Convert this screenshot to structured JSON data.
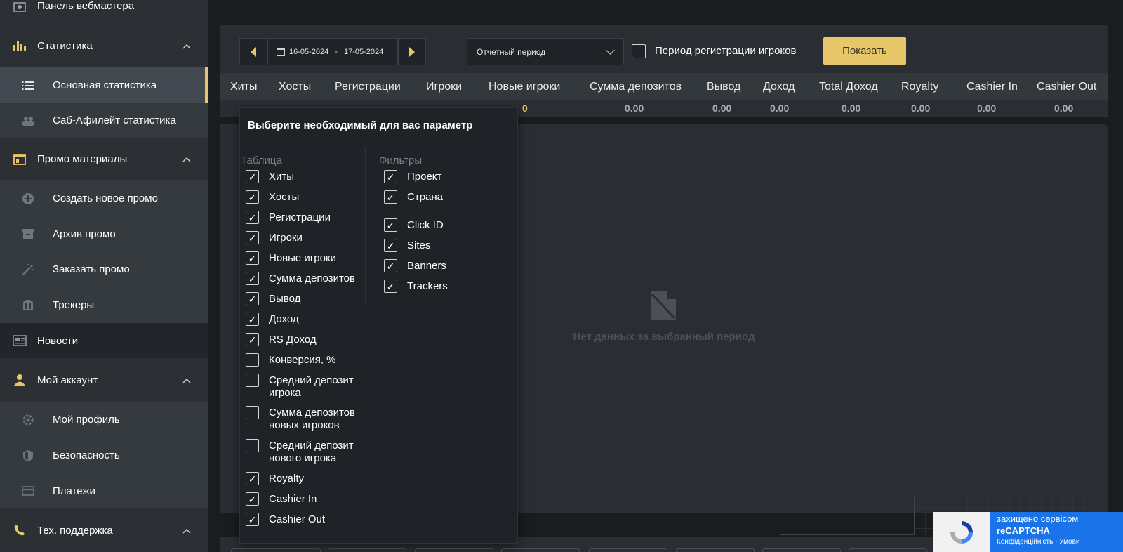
{
  "sidebar": {
    "items": [
      {
        "label": "Панель вебмастера",
        "icon": "dashboard-icon"
      },
      {
        "label": "Статистика",
        "icon": "bar-chart-icon"
      },
      {
        "label": "Основная статистика",
        "icon": "list-icon"
      },
      {
        "label": "Саб-Афилейт статистика",
        "icon": "sub-affiliate-icon"
      },
      {
        "label": "Промо материалы",
        "icon": "promo-icon"
      },
      {
        "label": "Создать новое промо",
        "icon": "plus-circle-icon"
      },
      {
        "label": "Архив промо",
        "icon": "archive-icon"
      },
      {
        "label": "Заказать промо",
        "icon": "magic-wand-icon"
      },
      {
        "label": "Трекеры",
        "icon": "tracker-icon"
      },
      {
        "label": "Новости",
        "icon": "news-icon"
      },
      {
        "label": "Мой аккаунт",
        "icon": "user-icon"
      },
      {
        "label": "Мой профиль",
        "icon": "gear-icon"
      },
      {
        "label": "Безопасность",
        "icon": "shield-icon"
      },
      {
        "label": "Платежи",
        "icon": "card-icon"
      },
      {
        "label": "Тех. поддержка",
        "icon": "phone-icon"
      }
    ]
  },
  "filters": {
    "date_from": "16-05-2024",
    "date_sep": "-",
    "date_to": "17-05-2024",
    "period_select": "Отчетный период",
    "reg_period_label": "Период регистрации игроков",
    "show_button": "Показать"
  },
  "table": {
    "headers": [
      "Хиты",
      "Хосты",
      "Регистрации",
      "Игроки",
      "Новые игроки",
      "Сумма депозитов",
      "Вывод",
      "Доход",
      "Total Доход",
      "Royalty",
      "Cashier In",
      "Cashier Out"
    ],
    "values": [
      "0",
      "0.00",
      "0.00",
      "0.00",
      "0.00",
      "0.00",
      "0.00",
      "0.00"
    ]
  },
  "empty": {
    "message": "Нет данных за выбранный период"
  },
  "popover": {
    "title": "Выберите необходимый для вас параметр",
    "table_group": "Таблица",
    "filters_group": "Фильтры",
    "table_options": [
      {
        "label": "Хиты",
        "checked": true
      },
      {
        "label": "Хосты",
        "checked": true
      },
      {
        "label": "Регистрации",
        "checked": true
      },
      {
        "label": "Игроки",
        "checked": true
      },
      {
        "label": "Новые игроки",
        "checked": true
      },
      {
        "label": "Сумма депозитов",
        "checked": true
      },
      {
        "label": "Вывод",
        "checked": true
      },
      {
        "label": "Доход",
        "checked": true
      },
      {
        "label": "RS Доход",
        "checked": true
      },
      {
        "label": "Конверсия, %",
        "checked": false
      },
      {
        "label": "Средний депозит игрока",
        "checked": false
      },
      {
        "label": "Сумма депозитов новых игроков",
        "checked": false
      },
      {
        "label": "Средний депозит нового игрока",
        "checked": false
      },
      {
        "label": "Royalty",
        "checked": true
      },
      {
        "label": "Cashier In",
        "checked": true
      },
      {
        "label": "Cashier Out",
        "checked": true
      }
    ],
    "filter_options": [
      {
        "label": "Проект",
        "checked": true
      },
      {
        "label": "Страна",
        "checked": true
      },
      {
        "label": "Click ID",
        "checked": true
      },
      {
        "label": "Sites",
        "checked": true
      },
      {
        "label": "Banners",
        "checked": true
      },
      {
        "label": "Trackers",
        "checked": true
      }
    ]
  },
  "recaptcha": {
    "line1": "захищено сервісом",
    "line2": "reCAPTCHA",
    "line3": "Конфіденційність · Умови"
  },
  "colors": {
    "accent": "#e8c66a",
    "sidebar": "#2c3034",
    "panel": "#2a2e33"
  }
}
